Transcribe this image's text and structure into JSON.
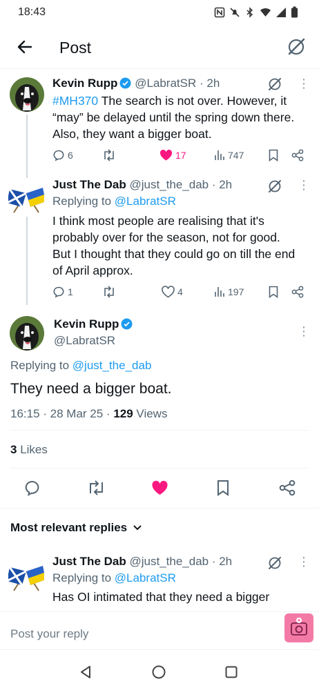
{
  "status_bar": {
    "time": "18:43"
  },
  "header": {
    "title": "Post"
  },
  "tweets": [
    {
      "name": "Kevin Rupp",
      "handle": "@LabratSR",
      "time": "· 2h",
      "hashtag": "#MH370",
      "text": "The search is not over. However, it “may” be delayed until the spring down there. Also, they want a bigger boat.",
      "replies": "6",
      "likes": "17",
      "views": "747"
    },
    {
      "name": "Just The Dab",
      "handle": "@just_the_dab",
      "time": "· 2h",
      "replying_label": "Replying to",
      "replying_to": "@LabratSR",
      "text": "I think most people are realising that it's probably over for the season, not for good. But I thought that they could go on till the end of April approx.",
      "replies": "1",
      "likes": "4",
      "views": "197"
    }
  ],
  "main_post": {
    "name": "Kevin Rupp",
    "handle": "@LabratSR",
    "replying_label": "Replying to",
    "replying_to": "@just_the_dab",
    "text": "They need a bigger boat.",
    "timestamp": "16:15 · 28 Mar 25 ·",
    "views_count": "129",
    "views_label": "Views",
    "likes_count": "3",
    "likes_label": "Likes"
  },
  "replies_section": {
    "sort_label": "Most relevant replies",
    "reply": {
      "name": "Just The Dab",
      "handle": "@just_the_dab",
      "time": "· 2h",
      "replying_label": "Replying to",
      "replying_to": "@LabratSR",
      "text": "Has OI intimated that they need a bigger"
    }
  },
  "composer": {
    "placeholder": "Post your reply"
  },
  "colors": {
    "accent": "#1d9bf0",
    "like": "#f91880",
    "fab": "#f47aa6"
  }
}
